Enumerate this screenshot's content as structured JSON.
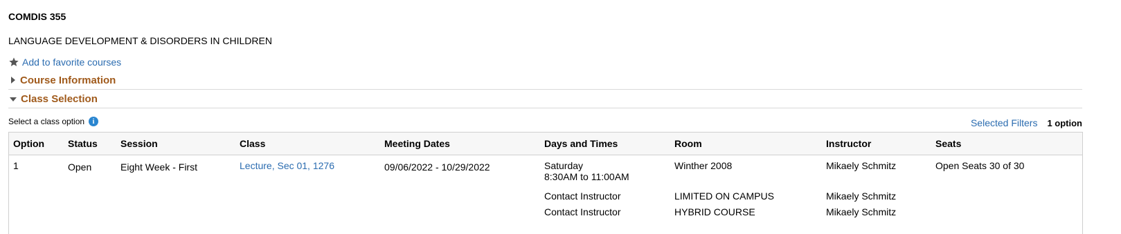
{
  "course": {
    "code": "COMDIS 355",
    "title": "LANGUAGE DEVELOPMENT & DISORDERS IN CHILDREN",
    "favorite_label": "Add to favorite courses"
  },
  "sections": {
    "info_label": "Course Information",
    "selection_label": "Class Selection"
  },
  "class_selection": {
    "prompt": "Select a class option",
    "filters_link": "Selected Filters",
    "option_count": "1 option",
    "columns": [
      "Option",
      "Status",
      "Session",
      "Class",
      "Meeting Dates",
      "Days and Times",
      "Room",
      "Instructor",
      "Seats"
    ],
    "rows": [
      {
        "option": "1",
        "status": "Open",
        "session": "Eight Week - First",
        "class_link": "Lecture, Sec 01, 1276",
        "meeting_dates": "09/06/2022 - 10/29/2022",
        "meetings": [
          {
            "days": "Saturday",
            "times": "8:30AM to 11:00AM",
            "room": "Winther 2008",
            "instructor": "Mikaely Schmitz"
          },
          {
            "days": "Contact Instructor",
            "times": "",
            "room": "LIMITED ON CAMPUS",
            "instructor": "Mikaely Schmitz"
          },
          {
            "days": "Contact Instructor",
            "times": "",
            "room": "HYBRID COURSE",
            "instructor": "Mikaely Schmitz"
          }
        ],
        "seats": "Open Seats 30 of 30"
      }
    ]
  },
  "colors": {
    "link": "#2b6cb0",
    "section_heading": "#a05a1b",
    "info_icon": "#2a86d0"
  },
  "icons": {
    "favorite": "star-icon",
    "info": "info-icon",
    "collapsed": "triangle-right-icon",
    "expanded": "triangle-down-icon"
  }
}
